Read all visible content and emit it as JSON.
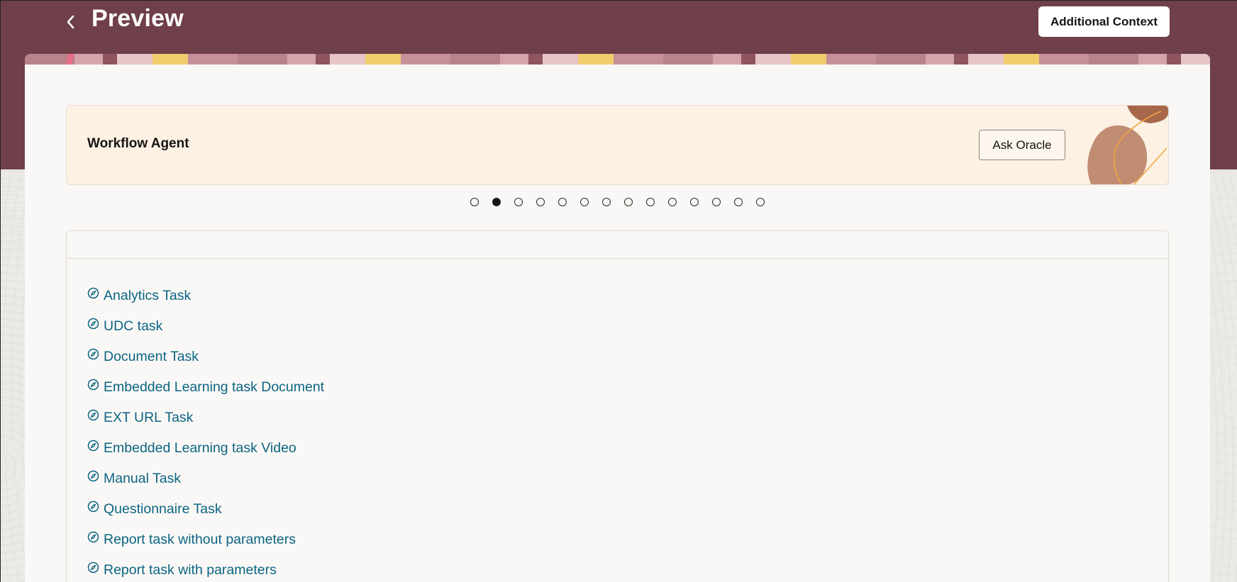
{
  "header": {
    "title": "Preview",
    "additional_context_label": "Additional Context",
    "background_color": "#6f3f4a"
  },
  "banner": {
    "title": "Workflow Agent",
    "ask_button_label": "Ask Oracle"
  },
  "carousel": {
    "total_dots": 14,
    "active_index": 1
  },
  "tasks": [
    {
      "label": "Analytics Task",
      "icon": "compass-icon"
    },
    {
      "label": "UDC task",
      "icon": "compass-icon"
    },
    {
      "label": "Document Task",
      "icon": "compass-icon"
    },
    {
      "label": "Embedded Learning task Document",
      "icon": "compass-icon"
    },
    {
      "label": "EXT URL Task",
      "icon": "compass-icon"
    },
    {
      "label": "Embedded Learning task Video",
      "icon": "compass-icon"
    },
    {
      "label": "Manual Task",
      "icon": "compass-icon"
    },
    {
      "label": "Questionnaire Task",
      "icon": "compass-icon"
    },
    {
      "label": "Report task without parameters",
      "icon": "compass-icon"
    },
    {
      "label": "Report task with parameters",
      "icon": "compass-icon"
    }
  ],
  "colors": {
    "link": "#0b6583",
    "banner_bg": "#fcf1e3",
    "card_bg": "#faf8f6"
  }
}
